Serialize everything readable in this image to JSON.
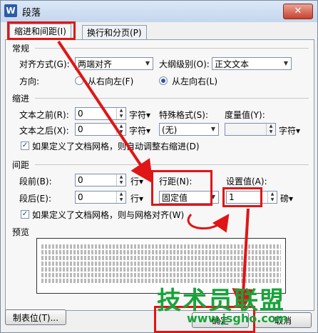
{
  "window": {
    "app_icon": "W",
    "title": "段落",
    "close": "✕"
  },
  "tabs": [
    {
      "label": "缩进和间距(I)",
      "active": true
    },
    {
      "label": "换行和分页(P)",
      "active": false
    }
  ],
  "general": {
    "section_label": "常规",
    "alignment_label": "对齐方式(G):",
    "alignment_value": "两端对齐",
    "outline_label": "大纲级别(O):",
    "outline_value": "正文文本",
    "direction_label": "方向:",
    "rtl_label": "从右向左(F)",
    "ltr_label": "从左向右(L)"
  },
  "indent": {
    "section_label": "缩进",
    "before_label": "文本之前(R):",
    "before_value": "0",
    "before_unit": "字符",
    "special_label": "特殊格式(S):",
    "special_value": "(无)",
    "measure_label": "度量值(Y):",
    "measure_value": "",
    "measure_unit": "字符",
    "after_label": "文本之后(X):",
    "after_value": "0",
    "after_unit": "字符",
    "grid_auto_label": "如果定义了文档网格，则自动调整右缩进(D)"
  },
  "spacing": {
    "section_label": "间距",
    "before_label": "段前(B):",
    "before_value": "0",
    "before_unit": "行",
    "after_label": "段后(E):",
    "after_value": "0",
    "after_unit": "行",
    "line_label": "行距(N):",
    "line_value": "固定值",
    "setting_label": "设置值(A):",
    "setting_value": "1",
    "setting_unit": "磅",
    "grid_snap_label": "如果定义了文档网格，则与网格对齐(W)"
  },
  "preview": {
    "section_label": "预览"
  },
  "buttons": {
    "tabs": "制表位(T)...",
    "ok": "确定",
    "cancel": "取消"
  },
  "watermark": {
    "text": "技术员联盟",
    "url": "www.jsgho.com"
  },
  "colors": {
    "annotation_red": "#e01515",
    "watermark_green": "#18a33a"
  }
}
